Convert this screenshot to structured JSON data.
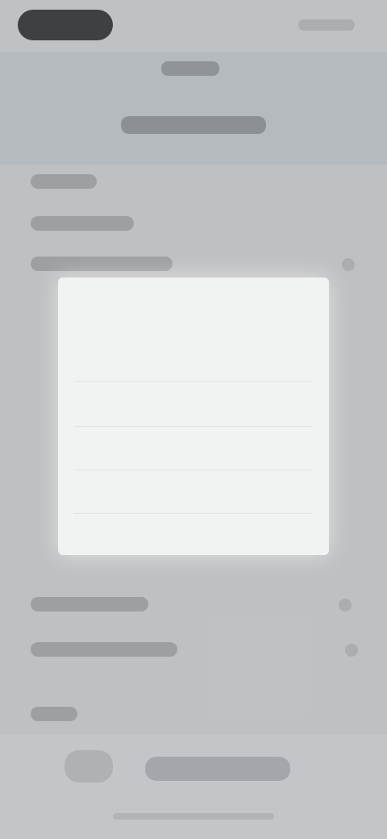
{
  "status_bar": {
    "time": "",
    "icons": [
      "signal-icon",
      "wifi-icon",
      "battery-icon"
    ]
  },
  "header": {
    "title": "",
    "subtitle": ""
  },
  "dialog": {
    "title": "",
    "message": "",
    "options": [
      {
        "label": ""
      },
      {
        "label": ""
      },
      {
        "label": ""
      },
      {
        "label": ""
      }
    ]
  },
  "colors": {
    "dialog_bg": "#f1f2f2",
    "link": "#4b6fa6",
    "background": "#c9ccce"
  }
}
